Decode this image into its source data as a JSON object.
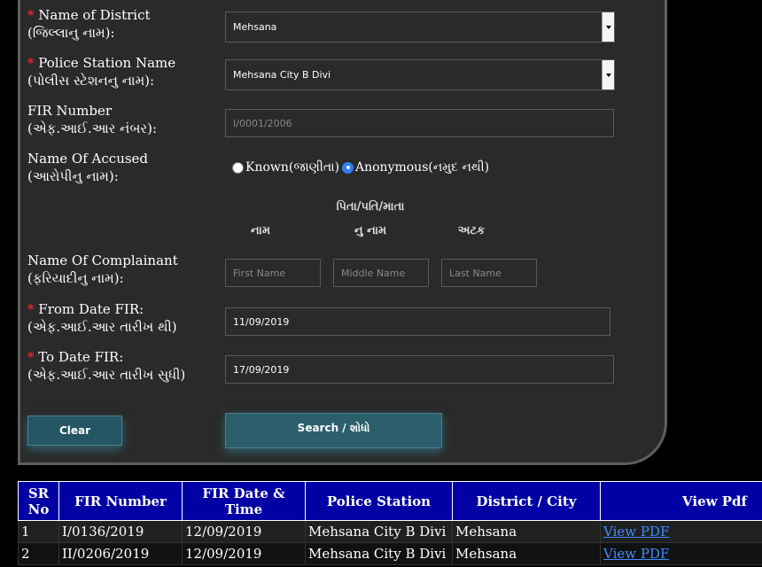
{
  "form": {
    "district": {
      "required": "*",
      "label_en": "Name of District",
      "label_gu": "(જિલ્લાનુ નામ):",
      "value": "Mehsana"
    },
    "police_station": {
      "required": "*",
      "label_en": "Police Station Name",
      "label_gu": "(પોલીસ સ્ટેશનનુ નામ):",
      "value": "Mehsana City B Divi"
    },
    "fir_number": {
      "label_en": "FIR Number",
      "label_gu": "(એફ.આઈ.આર નંબર):",
      "placeholder": "I/0001/2006"
    },
    "accused": {
      "label_en": "Name Of Accused",
      "label_gu": "(આરોપીનુ નામ):",
      "option_known": "Known(જાણીતા)",
      "option_anonymous": "Anonymous(નમુદ નથી)",
      "selected": "anonymous"
    },
    "name_headers": {
      "first": "નામ",
      "middle_line1": "પિતા/પતિ/માતા",
      "middle_line2": "નુ નામ",
      "last": "અટક"
    },
    "complainant": {
      "label_en": "Name Of Complainant",
      "label_gu": "(ફરિયાદીનુ નામ):",
      "first_placeholder": "First Name",
      "middle_placeholder": "Middle Name",
      "last_placeholder": "Last Name"
    },
    "from_date": {
      "required": "*",
      "label_en": "From Date FIR:",
      "label_gu": "(એફ.આઈ.આર તારીખ થી)",
      "value": "11/09/2019"
    },
    "to_date": {
      "required": "*",
      "label_en": "To Date FIR:",
      "label_gu": "(એફ.આઈ.આર તારીખ સુધી)",
      "value": "17/09/2019"
    },
    "clear_label": "Clear",
    "search_label": "Search / શોધો"
  },
  "table": {
    "headers": {
      "sr": "SR No",
      "fir_number": "FIR Number",
      "fir_date": "FIR Date & Time",
      "police_station": "Police Station",
      "district": "District / City",
      "view": "View Pdf"
    },
    "rows": [
      {
        "sr": "1",
        "fir_number": "I/0136/2019",
        "fir_date": "12/09/2019",
        "police_station": "Mehsana City B Divi",
        "district": "Mehsana",
        "view": "View PDF"
      },
      {
        "sr": "2",
        "fir_number": "II/0206/2019",
        "fir_date": "12/09/2019",
        "police_station": "Mehsana City B Divi",
        "district": "Mehsana",
        "view": "View PDF"
      }
    ]
  },
  "colors": {
    "header_blue": "#0000a4",
    "required_red": "#ff2d2d",
    "link_blue": "#3d8cff",
    "button_teal": "#265563"
  }
}
